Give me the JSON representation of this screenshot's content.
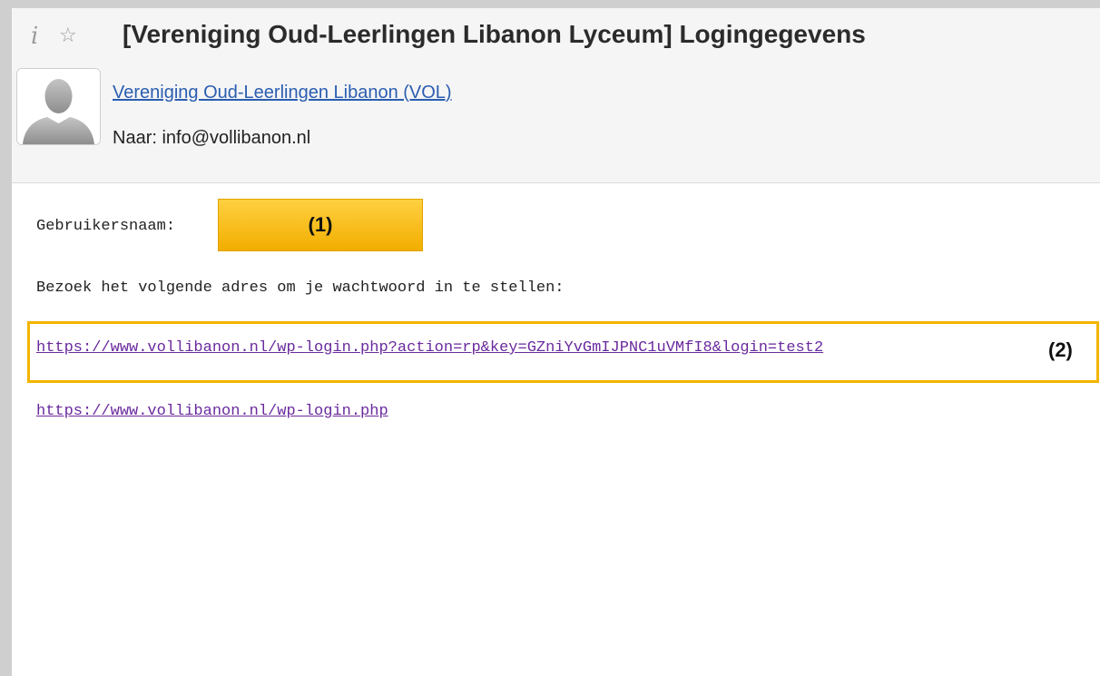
{
  "header": {
    "subject": "[Vereniging Oud-Leerlingen Libanon Lyceum] Logingegevens",
    "info_icon": "i",
    "star_icon": "☆",
    "sender_name": "Vereniging Oud-Leerlingen Libanon (VOL)",
    "recipient_line": "Naar: info@vollibanon.nl",
    "avatar_icon": "user-silhouette-icon"
  },
  "body": {
    "username_label": "Gebruikersnaam:",
    "username_annotation": "(1)",
    "instruction": "Bezoek het volgende adres om je wachtwoord in te stellen:",
    "reset_link": "https://www.vollibanon.nl/wp-login.php?action=rp&key=GZniYvGmIJPNC1uVMfI8&login=test2",
    "reset_annotation": "(2)",
    "login_link": "https://www.vollibanon.nl/wp-login.php"
  },
  "colors": {
    "highlight": "#f4b400",
    "link_visited": "#6a2a9e",
    "sender_link": "#2a5db0"
  }
}
